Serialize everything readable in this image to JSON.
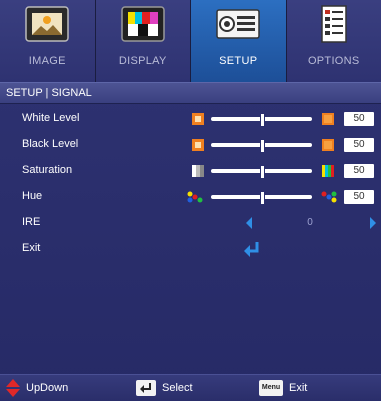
{
  "tabs": [
    {
      "label": "IMAGE",
      "icon": "image-icon"
    },
    {
      "label": "DISPLAY",
      "icon": "display-icon"
    },
    {
      "label": "SETUP",
      "icon": "projector-icon",
      "active": true
    },
    {
      "label": "OPTIONS",
      "icon": "checklist-icon"
    }
  ],
  "header": {
    "breadcrumb": "SETUP | SIGNAL"
  },
  "rows": [
    {
      "label": "White Level",
      "value": "50",
      "level": 50
    },
    {
      "label": "Black Level",
      "value": "50",
      "level": 50
    },
    {
      "label": "Saturation",
      "value": "50",
      "level": 50
    },
    {
      "label": "Hue",
      "value": "50",
      "level": 50
    },
    {
      "label": "IRE",
      "value": "0"
    },
    {
      "label": "Exit"
    }
  ],
  "footer": {
    "updown_label": "UpDown",
    "select_label": "Select",
    "menu_key": "Menu",
    "exit_label": "Exit"
  },
  "colors": {
    "accent": "#2f8fe6",
    "active_tab": "#2566b6",
    "background": "#2a2e6e"
  }
}
